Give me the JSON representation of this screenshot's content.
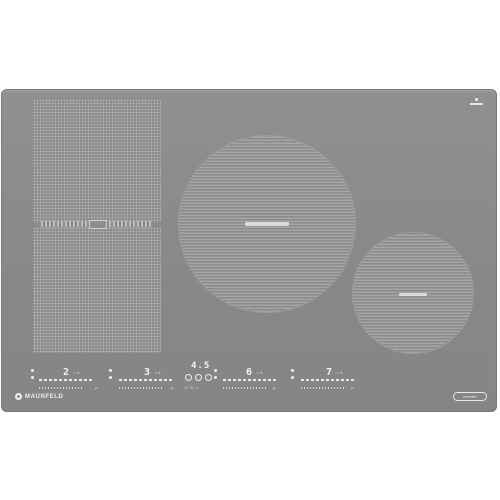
{
  "brand": {
    "logo_text": "MAUNFELD",
    "inverter_badge": "Inverter"
  },
  "controls": {
    "zone_displays": [
      "2",
      "3",
      "6",
      "7"
    ],
    "timer_display": "4.5",
    "unit_labels": [
      "ᵖ ᴮ",
      "ᵖ ᴮ",
      "ᵖ ᴮ",
      "ᵖ ᴮ"
    ],
    "left_letters": [
      "P",
      "P",
      "P",
      "P"
    ]
  },
  "colors": {
    "surface": "#88898b",
    "pattern": "#a5a6a8",
    "print": "#f0f0f0"
  },
  "icons": [
    "brand-logo-icon",
    "power-icon",
    "lock-icon",
    "timer-minus-icon",
    "timer-plus-icon",
    "bridge-icon"
  ]
}
